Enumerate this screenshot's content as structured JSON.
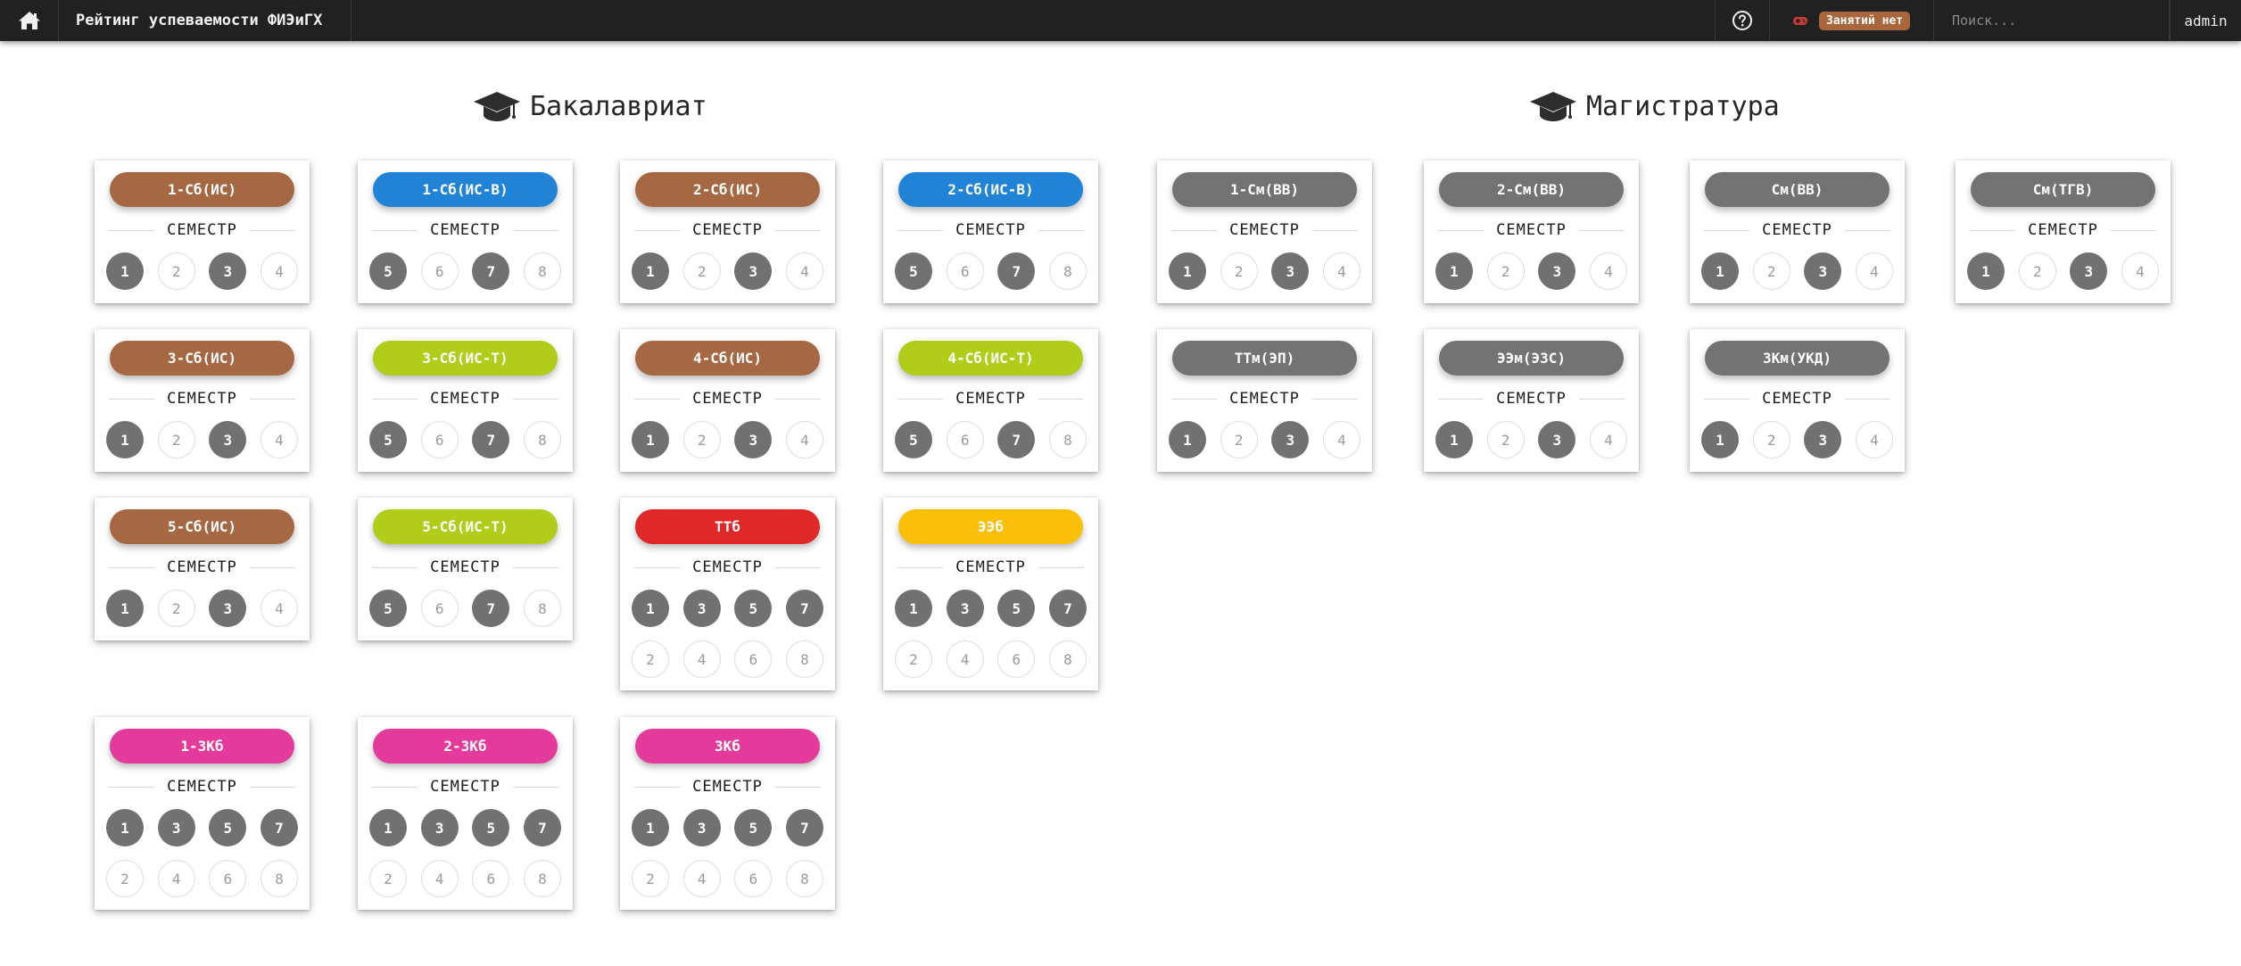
{
  "header": {
    "brand": "Рейтинг успеваемости ФИЭиГХ",
    "status_badge": "Занятий нет",
    "search_placeholder": "Поиск...",
    "user": "admin"
  },
  "sections": {
    "bachelor": {
      "title": "Бакалавриат"
    },
    "master": {
      "title": "Магистратура"
    }
  },
  "semester_label": "СЕМЕСТР",
  "colors": {
    "brown": "#a56843",
    "blue": "#2183d6",
    "lime": "#b2cc1a",
    "red": "#e02828",
    "yellow": "#fcbf07",
    "pink": "#e43a9b",
    "gray": "#737373",
    "badge": "#a9653c"
  },
  "groups": [
    {
      "name": "1-Сб(ИС)",
      "color": "brown",
      "semesters": [
        "1",
        "2",
        "3",
        "4"
      ],
      "active": [
        "1",
        "3"
      ]
    },
    {
      "name": "1-Сб(ИС-В)",
      "color": "blue",
      "semesters": [
        "5",
        "6",
        "7",
        "8"
      ],
      "active": [
        "5",
        "7"
      ]
    },
    {
      "name": "2-Сб(ИС)",
      "color": "brown",
      "semesters": [
        "1",
        "2",
        "3",
        "4"
      ],
      "active": [
        "1",
        "3"
      ]
    },
    {
      "name": "2-Сб(ИС-В)",
      "color": "blue",
      "semesters": [
        "5",
        "6",
        "7",
        "8"
      ],
      "active": [
        "5",
        "7"
      ]
    },
    {
      "name": "3-Сб(ИС)",
      "color": "brown",
      "semesters": [
        "1",
        "2",
        "3",
        "4"
      ],
      "active": [
        "1",
        "3"
      ]
    },
    {
      "name": "3-Сб(ИС-Т)",
      "color": "lime",
      "semesters": [
        "5",
        "6",
        "7",
        "8"
      ],
      "active": [
        "5",
        "7"
      ]
    },
    {
      "name": "4-Сб(ИС)",
      "color": "brown",
      "semesters": [
        "1",
        "2",
        "3",
        "4"
      ],
      "active": [
        "1",
        "3"
      ]
    },
    {
      "name": "4-Сб(ИС-Т)",
      "color": "lime",
      "semesters": [
        "5",
        "6",
        "7",
        "8"
      ],
      "active": [
        "5",
        "7"
      ]
    },
    {
      "name": "5-Сб(ИС)",
      "color": "brown",
      "semesters": [
        "1",
        "2",
        "3",
        "4"
      ],
      "active": [
        "1",
        "3"
      ]
    },
    {
      "name": "5-Сб(ИС-Т)",
      "color": "lime",
      "semesters": [
        "5",
        "6",
        "7",
        "8"
      ],
      "active": [
        "5",
        "7"
      ]
    },
    {
      "name": "ТТб",
      "color": "red",
      "semesters": [
        "1",
        "3",
        "5",
        "7",
        "2",
        "4",
        "6",
        "8"
      ],
      "active": [
        "1",
        "3",
        "5",
        "7"
      ]
    },
    {
      "name": "ЭЭб",
      "color": "yellow",
      "semesters": [
        "1",
        "3",
        "5",
        "7",
        "2",
        "4",
        "6",
        "8"
      ],
      "active": [
        "1",
        "3",
        "5",
        "7"
      ]
    },
    {
      "name": "1-ЗКб",
      "color": "pink",
      "semesters": [
        "1",
        "3",
        "5",
        "7",
        "2",
        "4",
        "6",
        "8"
      ],
      "active": [
        "1",
        "3",
        "5",
        "7"
      ]
    },
    {
      "name": "2-ЗКб",
      "color": "pink",
      "semesters": [
        "1",
        "3",
        "5",
        "7",
        "2",
        "4",
        "6",
        "8"
      ],
      "active": [
        "1",
        "3",
        "5",
        "7"
      ]
    },
    {
      "name": "ЗКб",
      "color": "pink",
      "semesters": [
        "1",
        "3",
        "5",
        "7",
        "2",
        "4",
        "6",
        "8"
      ],
      "active": [
        "1",
        "3",
        "5",
        "7"
      ]
    },
    {
      "name": "1-См(ВВ)",
      "color": "gray",
      "semesters": [
        "1",
        "2",
        "3",
        "4"
      ],
      "active": [
        "1",
        "3"
      ]
    },
    {
      "name": "2-См(ВВ)",
      "color": "gray",
      "semesters": [
        "1",
        "2",
        "3",
        "4"
      ],
      "active": [
        "1",
        "3"
      ]
    },
    {
      "name": "См(ВВ)",
      "color": "gray",
      "semesters": [
        "1",
        "2",
        "3",
        "4"
      ],
      "active": [
        "1",
        "3"
      ]
    },
    {
      "name": "См(ТГВ)",
      "color": "gray",
      "semesters": [
        "1",
        "2",
        "3",
        "4"
      ],
      "active": [
        "1",
        "3"
      ]
    },
    {
      "name": "ТТм(ЭП)",
      "color": "gray",
      "semesters": [
        "1",
        "2",
        "3",
        "4"
      ],
      "active": [
        "1",
        "3"
      ]
    },
    {
      "name": "ЭЭм(ЭЗС)",
      "color": "gray",
      "semesters": [
        "1",
        "2",
        "3",
        "4"
      ],
      "active": [
        "1",
        "3"
      ]
    },
    {
      "name": "ЗКм(УКД)",
      "color": "gray",
      "semesters": [
        "1",
        "2",
        "3",
        "4"
      ],
      "active": [
        "1",
        "3"
      ]
    }
  ]
}
